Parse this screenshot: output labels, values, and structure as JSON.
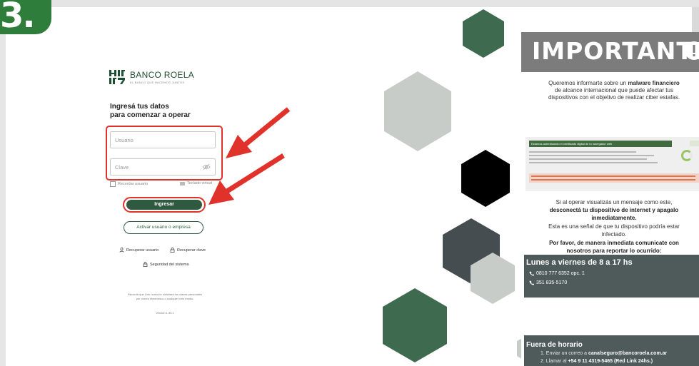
{
  "step": {
    "number": "3."
  },
  "login": {
    "brand_name": "BANCO ROELA",
    "brand_tagline": "EL BANCO QUE HACEMOS JUNTOS",
    "headline_line1": "Ingresá tus datos",
    "headline_line2": "para comenzar a operar",
    "username_placeholder": "Usuario",
    "password_placeholder": "Clave",
    "remember_label": "Recordar usuario",
    "virtual_keyboard_label": "Teclado virtual",
    "submit_label": "Ingresar",
    "activate_label": "Activar usuario o empresa",
    "recover_user_label": "Recuperar usuario",
    "recover_password_label": "Recuperar clave",
    "security_label": "Seguridad del sistema",
    "footnote_line1": "Recordá que Link nunca te solicitará tus claves personales",
    "footnote_line2": "por correo electrónico o cualquier otro medio.",
    "version": "Versión 1.30.1"
  },
  "infographic": {
    "banner": "IMPORTANTE",
    "intro_prefix": "Queremos informarte sobre un ",
    "intro_bold": "malware financiero",
    "intro_line2": "de alcance internacional que puede afectar tus",
    "intro_line3": "dispositivos con el objetivo de realizar ciber estafas.",
    "screen_header": "Estamos autenticando el certificado digital de tu navegador web",
    "msg_line1": "Si al operar visualizás un mensaje como este,",
    "msg_line2": "desconectá tu dispositivo de internet y apagalo",
    "msg_line3": "inmediatamente.",
    "msg_line4": "Esta es una señal de que tu dispositivo podría estar",
    "msg_line5": "infectado.",
    "msg_line6": "Por favor, de manera inmediata comunicate con",
    "msg_line7": "nosotros para reportar lo ocurrido:",
    "hours_title": "Lunes a viernes de 8 a 17 hs",
    "phone1": "0810 777 6352 opc. 1",
    "phone2": "351 835-5170",
    "after_title": "Fuera de horario",
    "after_1_prefix": "1. Enviar un correo a ",
    "after_1_bold": "canalseguro@bancoroela.com.ar",
    "after_2_prefix": "2. Llamar al ",
    "after_2_bold": "+54 9 11 4319-5465 (Red Link 24hs.)"
  },
  "colors": {
    "accent_red": "#e0312b",
    "brand_green": "#2f5a3f",
    "hex_green": "#3e6b50",
    "hex_dark": "#464d50",
    "hex_light": "#c8ccc8",
    "panel_gray": "#4f5b5b"
  }
}
